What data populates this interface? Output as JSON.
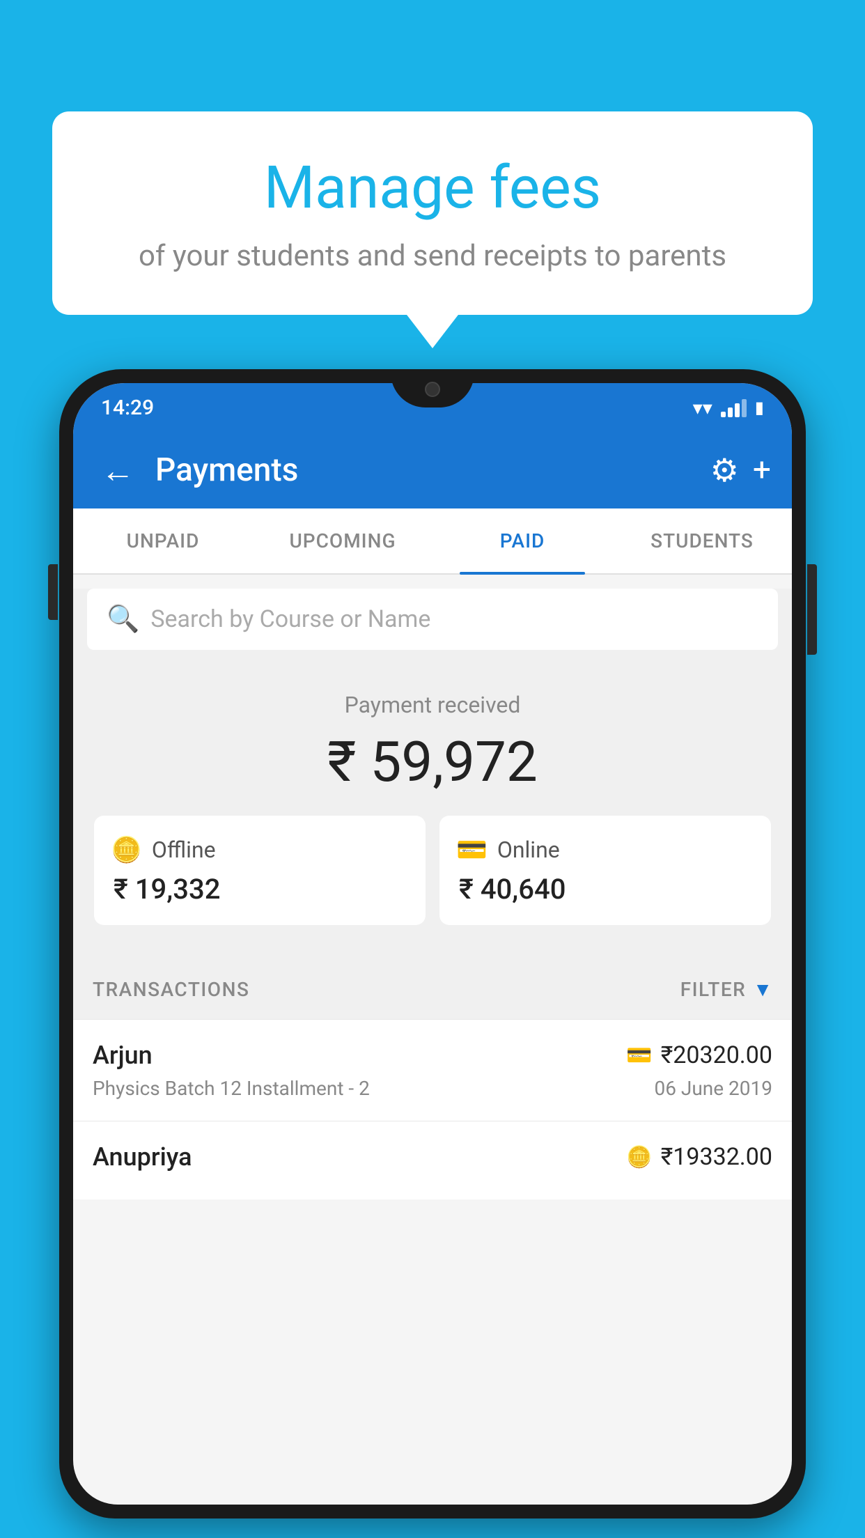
{
  "background_color": "#1ab3e8",
  "speech_bubble": {
    "title": "Manage fees",
    "subtitle": "of your students and send receipts to parents"
  },
  "phone": {
    "status_bar": {
      "time": "14:29"
    },
    "app_bar": {
      "title": "Payments",
      "back_label": "←",
      "settings_icon": "⚙",
      "add_icon": "+"
    },
    "tabs": [
      {
        "label": "UNPAID",
        "active": false
      },
      {
        "label": "UPCOMING",
        "active": false
      },
      {
        "label": "PAID",
        "active": true
      },
      {
        "label": "STUDENTS",
        "active": false
      }
    ],
    "search": {
      "placeholder": "Search by Course or Name"
    },
    "payment_section": {
      "label": "Payment received",
      "total_amount": "₹ 59,972",
      "offline": {
        "type": "Offline",
        "amount": "₹ 19,332"
      },
      "online": {
        "type": "Online",
        "amount": "₹ 40,640"
      }
    },
    "transactions": {
      "label": "TRANSACTIONS",
      "filter_label": "FILTER",
      "items": [
        {
          "name": "Arjun",
          "course": "Physics Batch 12 Installment - 2",
          "amount": "₹20320.00",
          "date": "06 June 2019",
          "payment_type": "card"
        },
        {
          "name": "Anupriya",
          "course": "",
          "amount": "₹19332.00",
          "date": "",
          "payment_type": "offline"
        }
      ]
    }
  }
}
